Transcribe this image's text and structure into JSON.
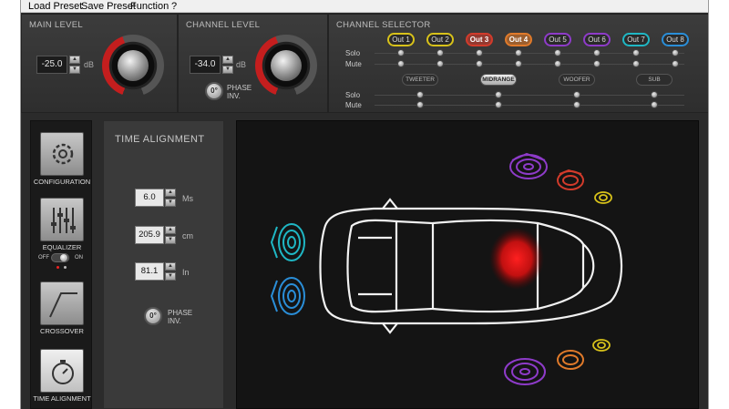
{
  "menu": {
    "items": [
      "Load Preset",
      "Save Preset",
      "Function",
      "?"
    ]
  },
  "main_level": {
    "title": "MAIN LEVEL",
    "value": "-25.0",
    "unit": "dB"
  },
  "channel_level": {
    "title": "CHANNEL LEVEL",
    "value": "-34.0",
    "unit": "dB",
    "phase_glyph": "0°",
    "phase_label_1": "PHASE",
    "phase_label_2": "INV."
  },
  "channel_selector": {
    "title": "CHANNEL SELECTOR",
    "outputs": [
      {
        "label": "Out 1",
        "color": "#d8c21a",
        "selected": false
      },
      {
        "label": "Out 2",
        "color": "#d8c21a",
        "selected": false
      },
      {
        "label": "Out 3",
        "color": "#d23b2b",
        "selected": true
      },
      {
        "label": "Out 4",
        "color": "#e07a2a",
        "selected": true
      },
      {
        "label": "Out 5",
        "color": "#8e3bc9",
        "selected": false
      },
      {
        "label": "Out 6",
        "color": "#8e3bc9",
        "selected": false
      },
      {
        "label": "Out 7",
        "color": "#1fb7c4",
        "selected": false
      },
      {
        "label": "Out 8",
        "color": "#2a8ed8",
        "selected": false
      }
    ],
    "solo_label": "Solo",
    "mute_label": "Mute",
    "bands": [
      {
        "label": "TWEETER",
        "active": false
      },
      {
        "label": "MIDRANGE",
        "active": true
      },
      {
        "label": "WOOFER",
        "active": false
      },
      {
        "label": "SUB",
        "active": false
      }
    ]
  },
  "sidebar": {
    "items": [
      {
        "label": "CONFIGURATION",
        "icon": "gear-icon",
        "active": false
      },
      {
        "label": "EQUALIZER",
        "icon": "equalizer-icon",
        "active": false
      },
      {
        "label": "CROSSOVER",
        "icon": "crossover-icon",
        "active": false
      },
      {
        "label": "TIME ALIGNMENT",
        "icon": "stopwatch-icon",
        "active": true
      }
    ],
    "eq_toggle": {
      "off_label": "OFF",
      "on_label": "ON",
      "state": "on"
    }
  },
  "time_alignment": {
    "title": "TIME ALIGNMENT",
    "ms": {
      "value": "6.0",
      "unit": "Ms"
    },
    "cm": {
      "value": "205.9",
      "unit": "cm"
    },
    "in": {
      "value": "81.1",
      "unit": "In"
    },
    "phase_glyph": "0°",
    "phase_label_1": "PHASE",
    "phase_label_2": "INV."
  },
  "colors": {
    "accent_red": "#c41e1e",
    "tweeter": "#d8c21a",
    "midrange_left": "#d23b2b",
    "midrange_right": "#e07a2a",
    "woofer": "#8e3bc9",
    "sub": "#1fb7c4"
  }
}
